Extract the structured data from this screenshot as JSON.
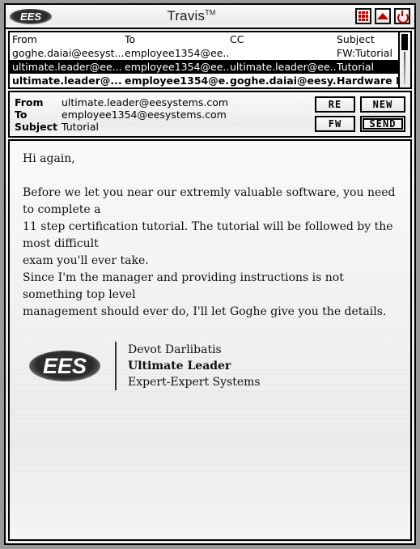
{
  "window": {
    "title": "Travis",
    "title_tm": "TM",
    "logo_text": "EES",
    "controls": [
      {
        "name": "apps-grid",
        "label": "grid-icon"
      },
      {
        "name": "minimize",
        "label": "triangle-up-icon"
      },
      {
        "name": "power",
        "label": "power-icon"
      }
    ],
    "accent_red": "#c00000",
    "frame_gray": "#9a9a9a"
  },
  "message_list": {
    "columns": [
      "From",
      "To",
      "CC",
      "Subject"
    ],
    "rows": [
      {
        "from": "goghe.daiai@eesyst...",
        "to": "employee1354@ee...",
        "cc": "",
        "subject": "FW:Tutorial",
        "state": "read"
      },
      {
        "from": "ultimate.leader@ee...",
        "to": "employee1354@ee...",
        "cc": "ultimate.leader@ee...",
        "subject": "Tutorial",
        "state": "selected"
      },
      {
        "from": "ultimate.leader@...",
        "to": "employee1354@e...",
        "cc": "goghe.daiai@eesy...",
        "subject": "Hardware Policy",
        "state": "unread"
      }
    ]
  },
  "header": {
    "from_label": "From",
    "from_value": "ultimate.leader@eesystems.com",
    "to_label": "To",
    "to_value": "employee1354@eesystems.com",
    "subject_label": "Subject",
    "subject_value": "Tutorial",
    "buttons": [
      {
        "key": "reply",
        "label": "RE"
      },
      {
        "key": "new",
        "label": "NEW"
      },
      {
        "key": "forward",
        "label": "FW"
      },
      {
        "key": "send",
        "label": "SEND"
      }
    ]
  },
  "body": {
    "text": "Hi again,\n\nBefore we let you near our extremly valuable software, you need to complete a\n11 step certification tutorial. The tutorial will be followed by the most difficult\nexam you'll ever take.\nSince I'm the manager and providing instructions is not something top level\nmanagement should ever do, I'll let Goghe give you the details."
  },
  "signature": {
    "logo_text": "EES",
    "name": "Devot Darlibatis",
    "title": "Ultimate Leader",
    "company": "Expert-Expert Systems"
  }
}
